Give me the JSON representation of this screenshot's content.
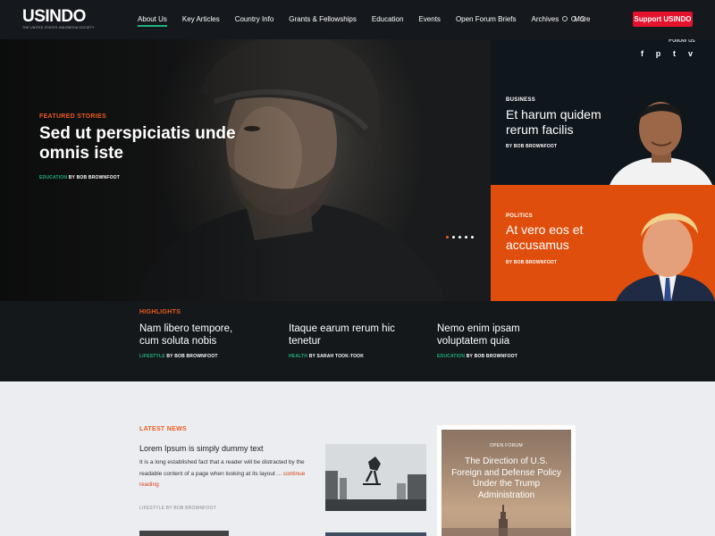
{
  "header": {
    "logo": "USINDO",
    "logo_tagline": "THE UNITED STATES-INDONESIA SOCIETY",
    "nav": [
      "About Us",
      "Key Articles",
      "Country Info",
      "Grants & Fellowships",
      "Education",
      "Events",
      "Open Forum Briefs",
      "Archives",
      "More"
    ],
    "active_nav": "About Us",
    "support_button": "Support USINDO",
    "accent_color": "#1db47c",
    "button_color": "#e4122c"
  },
  "social": {
    "label": "Follow us",
    "icons": [
      "facebook-icon",
      "pinterest-icon",
      "twitter-icon",
      "vimeo-icon"
    ],
    "glyphs": [
      "f",
      "p",
      "t",
      "v"
    ]
  },
  "hero": {
    "kicker": "FEATURED STORIES",
    "title": "Sed ut perspiciatis unde omnis iste",
    "category": "EDUCATION",
    "byline": "BY BOB BROWNFOOT",
    "slides": 5,
    "active_slide": 1
  },
  "side_stories": [
    {
      "category": "BUSINESS",
      "title": "Et harum quidem rerum facilis",
      "byline": "BY BOB BROWNFOOT"
    },
    {
      "category": "POLITICS",
      "title": "At vero eos et accusamus",
      "byline": "BY BOB BROWNFOOT"
    }
  ],
  "highlights": {
    "label": "HIGHLIGHTS",
    "items": [
      {
        "title": "Nam libero tempore, cum soluta nobis",
        "category": "LIFESTYLE",
        "byline": "BY BOB BROWNFOOT"
      },
      {
        "title": "Itaque earum rerum hic tenetur",
        "category": "HEALTH",
        "byline": "BY SARAH TOOK-TOOK"
      },
      {
        "title": "Nemo enim ipsam voluptatem quia",
        "category": "EDUCATION",
        "byline": "BY BOB BROWNFOOT"
      }
    ]
  },
  "latest": {
    "label": "LATEST NEWS",
    "title": "Lorem Ipsum is simply dummy text",
    "body": "It is a long established fact that a reader will be distracted by the readable content of a page when looking at its layout ... ",
    "link": "continue reading",
    "category": "LIFESTYLE",
    "byline": "BY BOB BROWNFOOT"
  },
  "promo": {
    "kicker": "OPEN FORUM",
    "title": "The Direction of U.S. Foreign and Defense Policy Under the Trump Administration"
  },
  "colors": {
    "orange": "#ec5b1f",
    "politics_panel": "#df4e0c",
    "dark": "#14181b",
    "green": "#1db47c"
  }
}
